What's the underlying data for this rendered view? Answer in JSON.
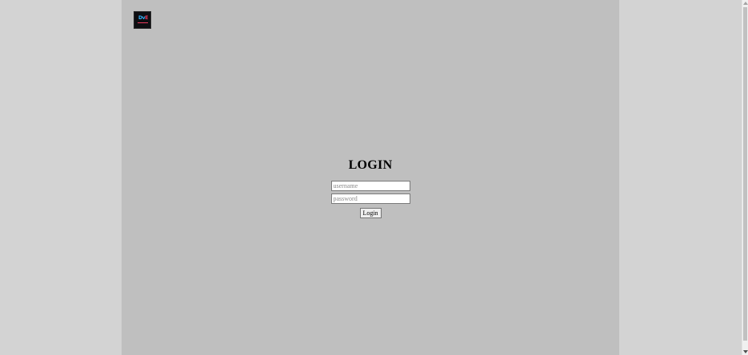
{
  "header": {
    "logo_icon": "site-logo-icon",
    "logo_mark_main": "Dv",
    "logo_mark_accent": "E"
  },
  "login": {
    "title": "LOGIN",
    "username_placeholder": "username",
    "username_value": "",
    "password_placeholder": "password",
    "password_value": "",
    "submit_label": "Login"
  },
  "colors": {
    "page_background": "#d3d3d3",
    "content_background": "#bfbfbf",
    "logo_background": "#0e0e12",
    "logo_blue": "#38b6ff",
    "logo_red": "#e83a5c"
  }
}
